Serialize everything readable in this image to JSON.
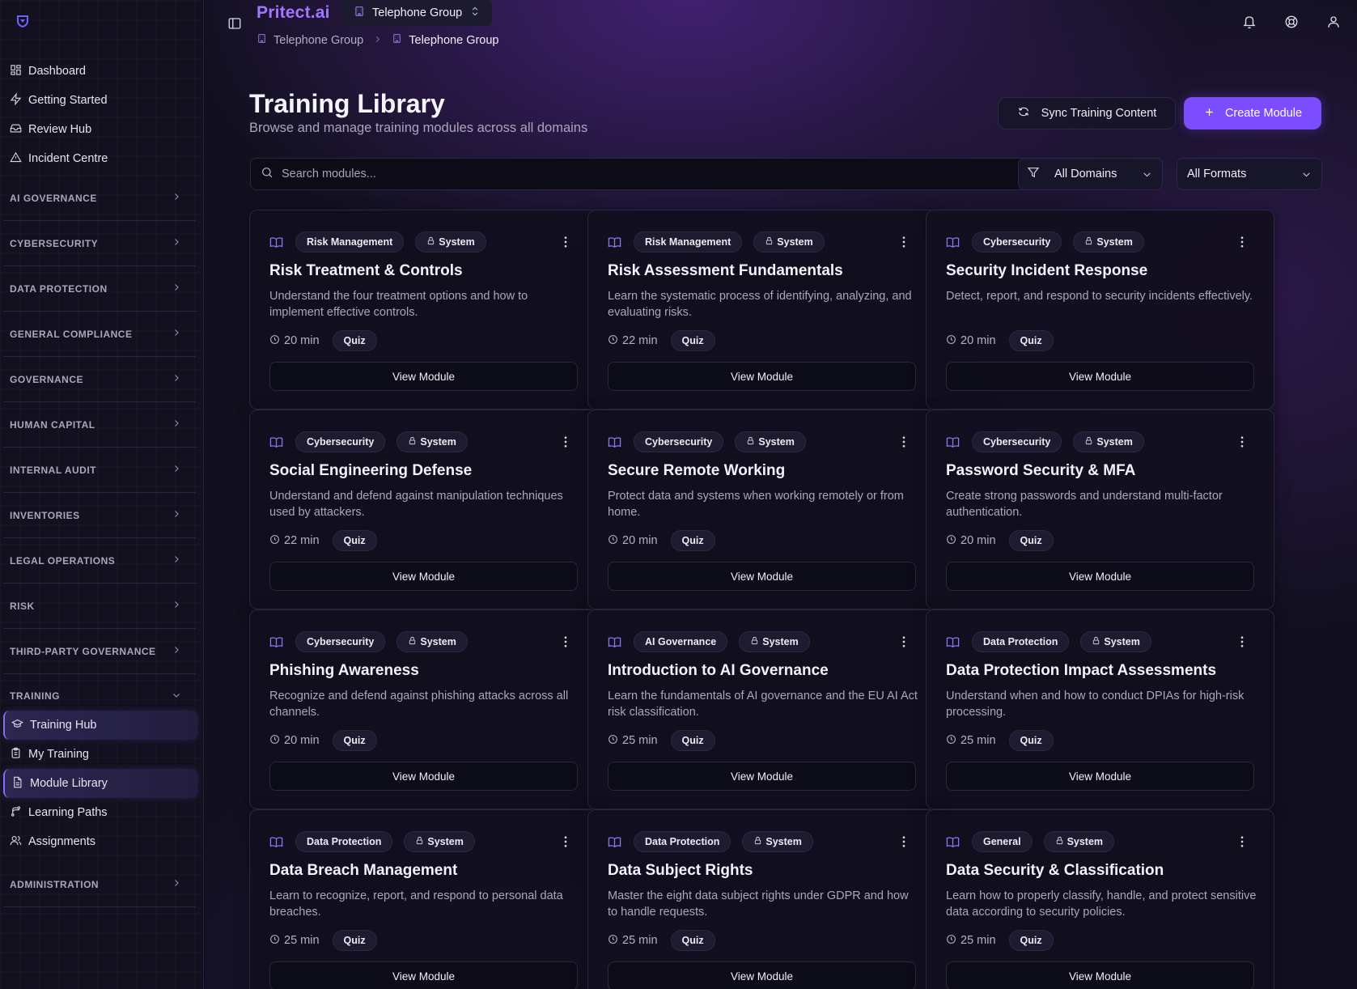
{
  "app": {
    "brand": "Pritect.ai"
  },
  "org_selector": {
    "label": "Telephone Group"
  },
  "breadcrumb": {
    "items": [
      "Telephone Group",
      "Telephone Group"
    ]
  },
  "sidebar": {
    "top_items": [
      {
        "label": "Dashboard",
        "icon": "dashboard-icon"
      },
      {
        "label": "Getting Started",
        "icon": "lightning-icon"
      },
      {
        "label": "Review Hub",
        "icon": "inbox-icon"
      },
      {
        "label": "Incident Centre",
        "icon": "warning-icon"
      }
    ],
    "sections": [
      "AI GOVERNANCE",
      "CYBERSECURITY",
      "DATA PROTECTION",
      "GENERAL COMPLIANCE",
      "GOVERNANCE",
      "HUMAN CAPITAL",
      "INTERNAL AUDIT",
      "INVENTORIES",
      "LEGAL OPERATIONS",
      "RISK",
      "THIRD-PARTY GOVERNANCE",
      "TRAINING",
      "ADMINISTRATION"
    ],
    "training_items": [
      {
        "label": "Training Hub",
        "icon": "graduation-cap-icon",
        "active": true
      },
      {
        "label": "My Training",
        "icon": "clipboard-icon",
        "active": false
      },
      {
        "label": "Module Library",
        "icon": "document-icon",
        "active": true
      },
      {
        "label": "Learning Paths",
        "icon": "branch-icon",
        "active": false
      },
      {
        "label": "Assignments",
        "icon": "users-icon",
        "active": false
      }
    ]
  },
  "page": {
    "title": "Training Library",
    "subtitle": "Browse and manage training modules across all domains",
    "sync_label": "Sync Training Content",
    "create_label": "Create Module",
    "search_placeholder": "Search modules...",
    "domain_filter": "All Domains",
    "format_filter": "All Formats"
  },
  "modules": [
    {
      "domain": "Risk Management",
      "source": "System",
      "title": "Risk Treatment & Controls",
      "description": "Understand the four treatment options and how to implement effective controls.",
      "duration": "20 min",
      "format": "Quiz",
      "action": "View Module"
    },
    {
      "domain": "Risk Management",
      "source": "System",
      "title": "Risk Assessment Fundamentals",
      "description": "Learn the systematic process of identifying, analyzing, and evaluating risks.",
      "duration": "22 min",
      "format": "Quiz",
      "action": "View Module"
    },
    {
      "domain": "Cybersecurity",
      "source": "System",
      "title": "Security Incident Response",
      "description": "Detect, report, and respond to security incidents effectively.",
      "duration": "20 min",
      "format": "Quiz",
      "action": "View Module"
    },
    {
      "domain": "Cybersecurity",
      "source": "System",
      "title": "Social Engineering Defense",
      "description": "Understand and defend against manipulation techniques used by attackers.",
      "duration": "22 min",
      "format": "Quiz",
      "action": "View Module"
    },
    {
      "domain": "Cybersecurity",
      "source": "System",
      "title": "Secure Remote Working",
      "description": "Protect data and systems when working remotely or from home.",
      "duration": "20 min",
      "format": "Quiz",
      "action": "View Module"
    },
    {
      "domain": "Cybersecurity",
      "source": "System",
      "title": "Password Security & MFA",
      "description": "Create strong passwords and understand multi-factor authentication.",
      "duration": "20 min",
      "format": "Quiz",
      "action": "View Module"
    },
    {
      "domain": "Cybersecurity",
      "source": "System",
      "title": "Phishing Awareness",
      "description": "Recognize and defend against phishing attacks across all channels.",
      "duration": "20 min",
      "format": "Quiz",
      "action": "View Module"
    },
    {
      "domain": "AI Governance",
      "source": "System",
      "title": "Introduction to AI Governance",
      "description": "Learn the fundamentals of AI governance and the EU AI Act risk classification.",
      "duration": "25 min",
      "format": "Quiz",
      "action": "View Module"
    },
    {
      "domain": "Data Protection",
      "source": "System",
      "title": "Data Protection Impact Assessments",
      "description": "Understand when and how to conduct DPIAs for high-risk processing.",
      "duration": "25 min",
      "format": "Quiz",
      "action": "View Module"
    },
    {
      "domain": "Data Protection",
      "source": "System",
      "title": "Data Breach Management",
      "description": "Learn to recognize, report, and respond to personal data breaches.",
      "duration": "25 min",
      "format": "Quiz",
      "action": "View Module"
    },
    {
      "domain": "Data Protection",
      "source": "System",
      "title": "Data Subject Rights",
      "description": "Master the eight data subject rights under GDPR and how to handle requests.",
      "duration": "25 min",
      "format": "Quiz",
      "action": "View Module"
    },
    {
      "domain": "General",
      "source": "System",
      "title": "Data Security & Classification",
      "description": "Learn how to properly classify, handle, and protect sensitive data according to security policies.",
      "duration": "25 min",
      "format": "Quiz",
      "action": "View Module"
    }
  ],
  "colors": {
    "accent": "#7c4dff",
    "brand": "#a277ff",
    "background": "#12101f"
  }
}
